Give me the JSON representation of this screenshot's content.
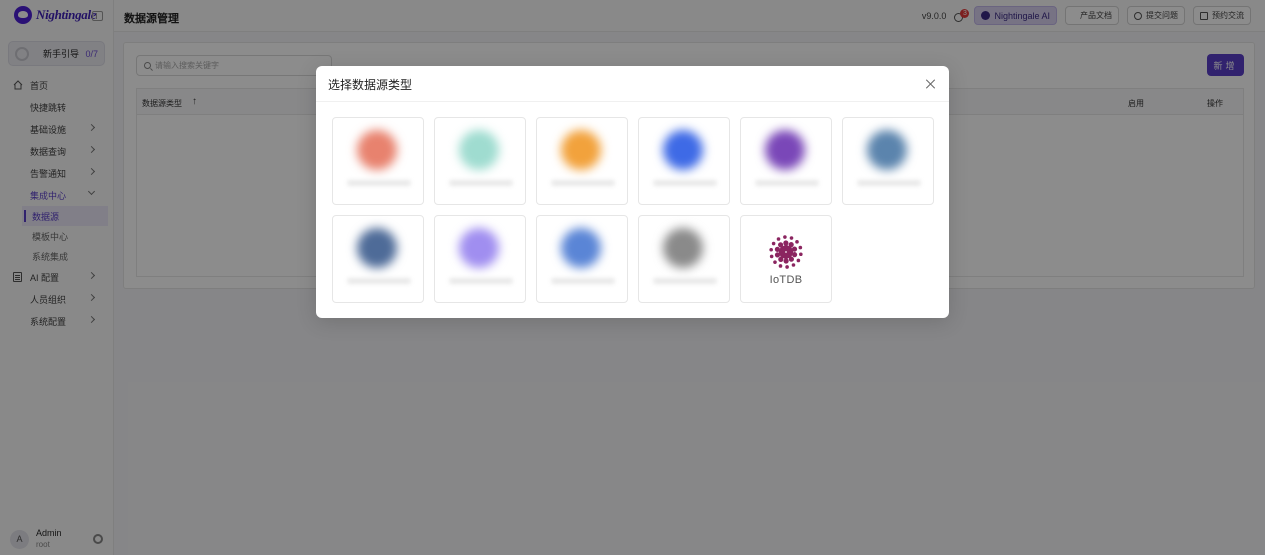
{
  "brand": {
    "name": "Nightingale"
  },
  "sidebar": {
    "guide": {
      "label": "新手引导",
      "count": "0/7"
    },
    "items": [
      {
        "label": "首页"
      },
      {
        "label": "快捷跳转"
      },
      {
        "label": "基础设施"
      },
      {
        "label": "数据查询"
      },
      {
        "label": "告警通知"
      },
      {
        "label": "集成中心"
      }
    ],
    "integration_sub": [
      {
        "label": "数据源"
      },
      {
        "label": "模板中心"
      },
      {
        "label": "系统集成"
      }
    ],
    "items_after": [
      {
        "label": "AI 配置"
      },
      {
        "label": "人员组织"
      },
      {
        "label": "系统配置"
      }
    ],
    "user": {
      "initial": "A",
      "name": "Admin",
      "role": "root"
    }
  },
  "header": {
    "title": "数据源管理",
    "version": "v9.0.0",
    "notification_count": "3",
    "ai_label": "Nightingale AI",
    "docs_label": "产品文档",
    "issue_label": "提交问题",
    "booking_label": "预约交流"
  },
  "main": {
    "search_placeholder": "请输入搜索关键字",
    "add_label": "新增",
    "columns": {
      "type": "数据源类型",
      "enabled": "启用",
      "actions": "操作"
    }
  },
  "modal": {
    "title": "选择数据源类型",
    "cards": [
      {
        "label": "",
        "color": "#e8826e"
      },
      {
        "label": "",
        "color": "#9fdcd0"
      },
      {
        "label": "",
        "color": "#f2a23c"
      },
      {
        "label": "",
        "color": "#3e6ae6"
      },
      {
        "label": "",
        "color": "#7a47b8"
      },
      {
        "label": "",
        "color": "#5b84ad"
      },
      {
        "label": "",
        "color": "#4e6b98"
      },
      {
        "label": "",
        "color": "#a08ef0"
      },
      {
        "label": "",
        "color": "#5a85d6"
      },
      {
        "label": "",
        "color": "#8a8a8a"
      },
      {
        "label": "IoTDB",
        "color": "#8b2560"
      }
    ]
  }
}
